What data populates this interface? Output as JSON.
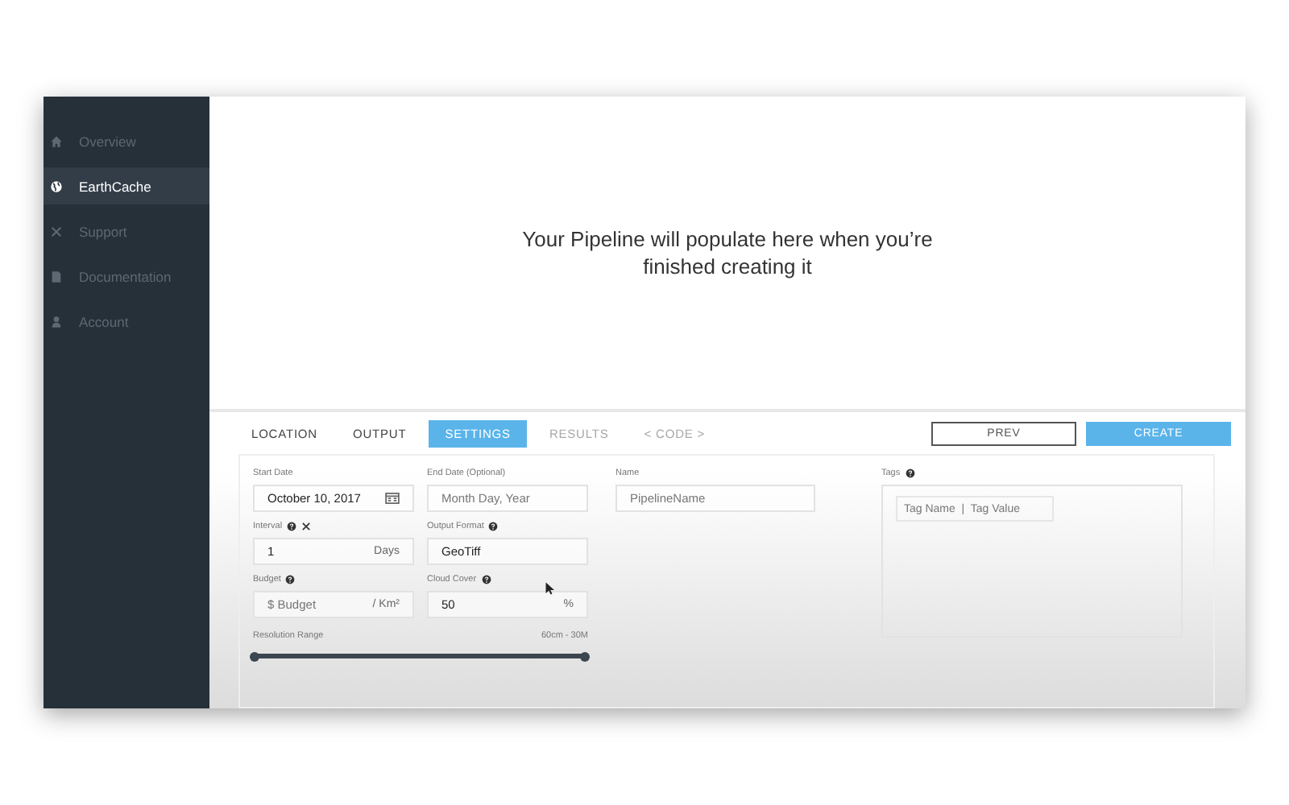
{
  "sidebar": {
    "items": [
      {
        "label": "Overview",
        "selected": false
      },
      {
        "label": "EarthCache",
        "selected": true
      },
      {
        "label": "Support",
        "selected": false
      },
      {
        "label": "Documentation",
        "selected": false
      },
      {
        "label": "Account",
        "selected": false
      }
    ]
  },
  "message": "Your Pipeline will populate here when you’re finished creating it",
  "tabs": [
    {
      "label": "LOCATION",
      "selected": false,
      "disabled": false
    },
    {
      "label": "OUTPUT",
      "selected": false,
      "disabled": false
    },
    {
      "label": "SETTINGS",
      "selected": true,
      "disabled": false
    },
    {
      "label": "RESULTS",
      "selected": false,
      "disabled": true
    },
    {
      "label": "< CODE >",
      "selected": false,
      "disabled": true
    }
  ],
  "buttons": [
    {
      "label": "PREV",
      "kind": "outline"
    },
    {
      "label": "CREATE",
      "kind": "primary"
    }
  ],
  "fields": [
    {
      "label": "Start Date",
      "value": "October 10, 2017",
      "kind": "date",
      "help": false,
      "tool": false
    },
    {
      "label": "End Date (Optional)",
      "placeholder": "Month Day, Year",
      "kind": "text",
      "help": false,
      "tool": false
    },
    {
      "label": "Interval",
      "value": "1",
      "suffix": "Days",
      "kind": "text",
      "help": true,
      "tool": true
    },
    {
      "label": "Output Format",
      "value": "GeoTiff",
      "kind": "text",
      "help": true,
      "tool": false
    },
    {
      "label": "Budget",
      "placeholder": "$ Budget",
      "suffix": "/ Km²",
      "kind": "text",
      "help": true,
      "tool": false
    },
    {
      "label": "Cloud Cover",
      "value": "50",
      "suffix": "%",
      "kind": "text",
      "help": true,
      "tool": false
    }
  ],
  "name_field": {
    "label": "Name",
    "placeholder": "PipelineName"
  },
  "tags": {
    "label": "Tags",
    "help": true,
    "placeholder": "Tag Name  |  Tag Value"
  },
  "resolution": {
    "label": "Resolution Range",
    "reading": "60cm - 30M",
    "thumbs": [
      {
        "level": 0
      },
      {
        "level": 1
      }
    ]
  }
}
